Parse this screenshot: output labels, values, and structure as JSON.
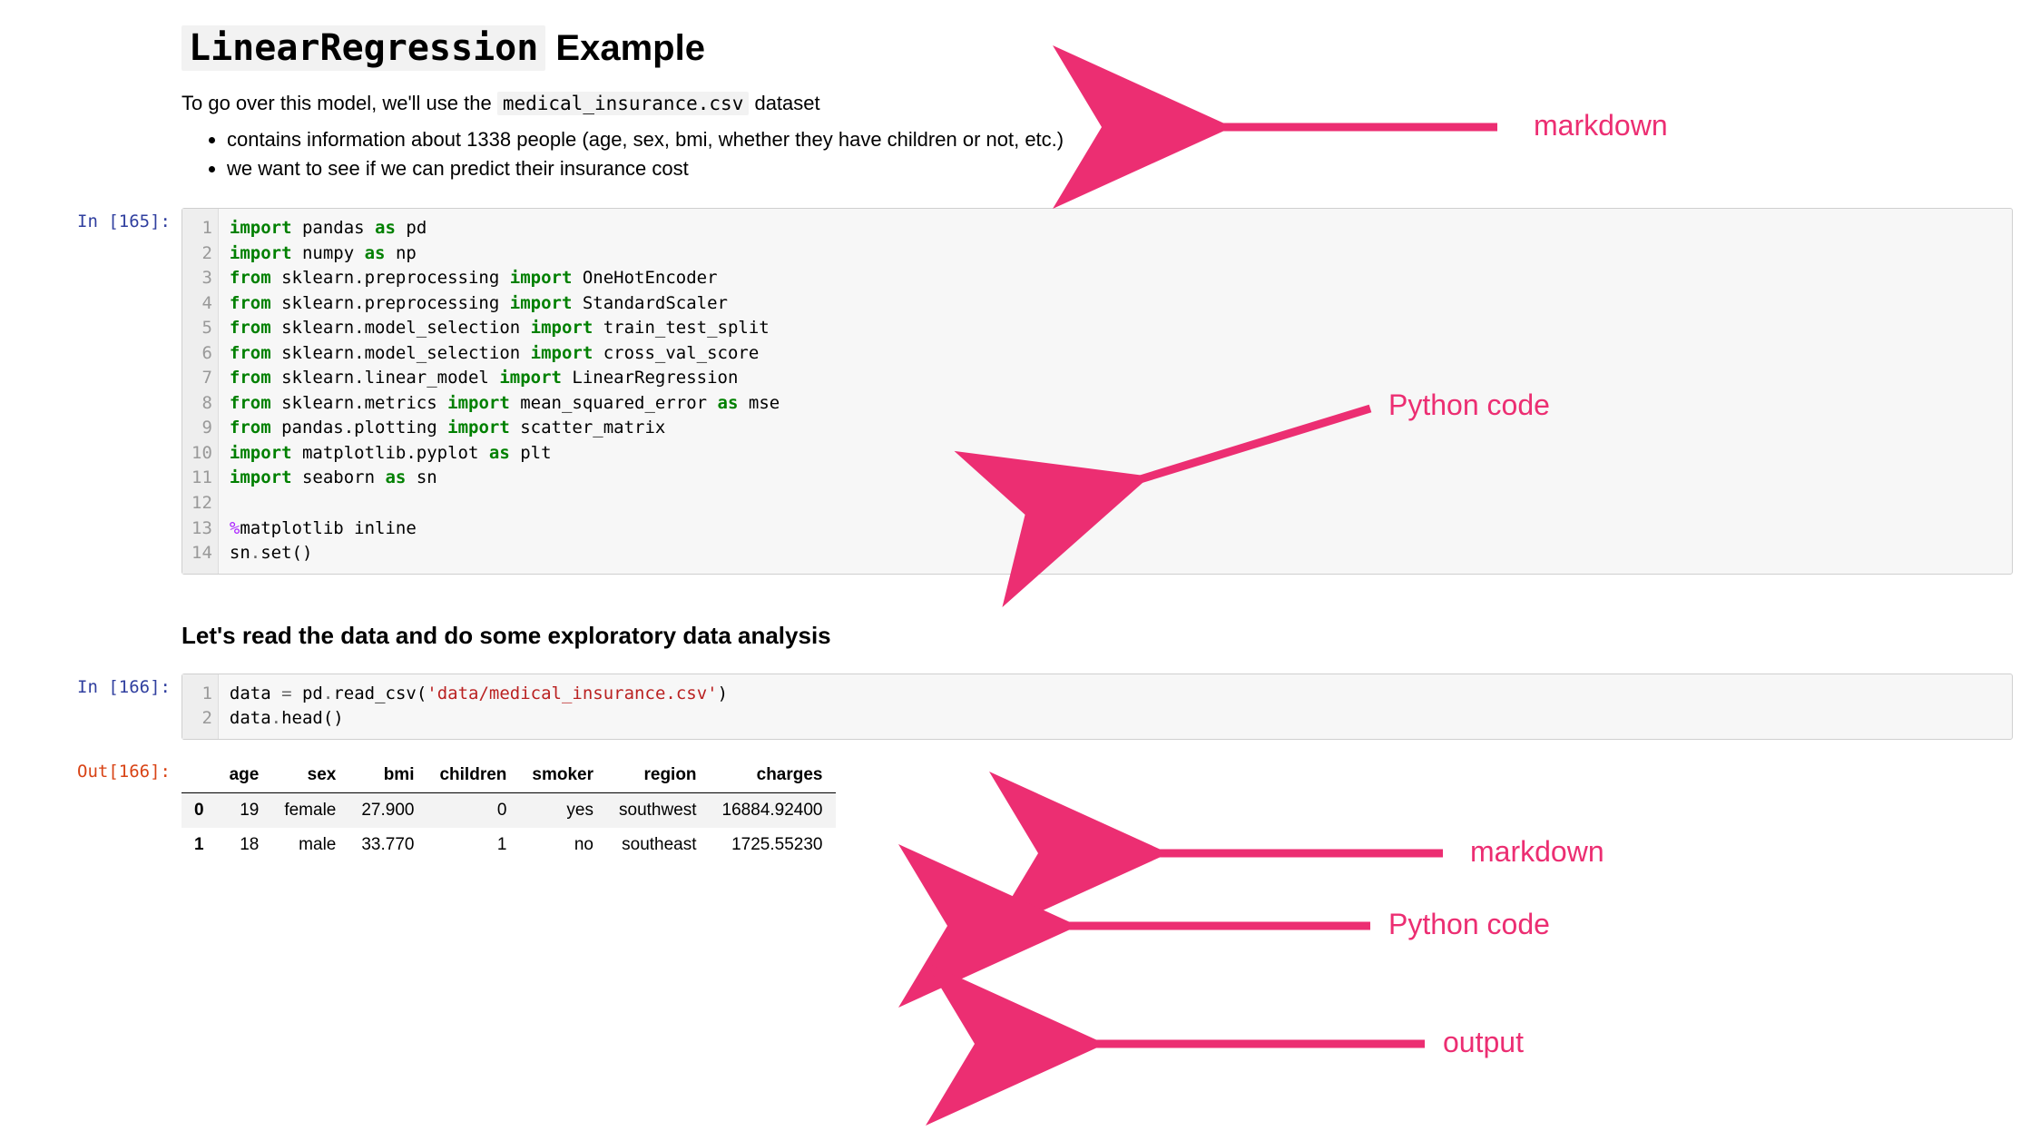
{
  "heading": {
    "code_part": "LinearRegression",
    "rest": " Example"
  },
  "intro": {
    "prefix": "To go over this model, we'll use the ",
    "code": "medical_insurance.csv",
    "suffix": " dataset"
  },
  "bullets": [
    "contains information about 1338 people (age, sex, bmi, whether they have children or not, etc.)",
    "we want to see if we can predict their insurance cost"
  ],
  "cell1": {
    "prompt": "In [165]:",
    "line_numbers": [
      "1",
      "2",
      "3",
      "4",
      "5",
      "6",
      "7",
      "8",
      "9",
      "10",
      "11",
      "12",
      "13",
      "14"
    ],
    "lines": [
      {
        "t": [
          {
            "c": "kw-green",
            "v": "import"
          },
          {
            "v": " pandas "
          },
          {
            "c": "kw-green",
            "v": "as"
          },
          {
            "v": " pd"
          }
        ]
      },
      {
        "t": [
          {
            "c": "kw-green",
            "v": "import"
          },
          {
            "v": " numpy "
          },
          {
            "c": "kw-green",
            "v": "as"
          },
          {
            "v": " np"
          }
        ]
      },
      {
        "t": [
          {
            "c": "kw-green",
            "v": "from"
          },
          {
            "v": " sklearn.preprocessing "
          },
          {
            "c": "kw-green",
            "v": "import"
          },
          {
            "v": " OneHotEncoder"
          }
        ]
      },
      {
        "t": [
          {
            "c": "kw-green",
            "v": "from"
          },
          {
            "v": " sklearn.preprocessing "
          },
          {
            "c": "kw-green",
            "v": "import"
          },
          {
            "v": " StandardScaler"
          }
        ]
      },
      {
        "t": [
          {
            "c": "kw-green",
            "v": "from"
          },
          {
            "v": " sklearn.model_selection "
          },
          {
            "c": "kw-green",
            "v": "import"
          },
          {
            "v": " train_test_split"
          }
        ]
      },
      {
        "t": [
          {
            "c": "kw-green",
            "v": "from"
          },
          {
            "v": " sklearn.model_selection "
          },
          {
            "c": "kw-green",
            "v": "import"
          },
          {
            "v": " cross_val_score"
          }
        ]
      },
      {
        "t": [
          {
            "c": "kw-green",
            "v": "from"
          },
          {
            "v": " sklearn.linear_model "
          },
          {
            "c": "kw-green",
            "v": "import"
          },
          {
            "v": " LinearRegression"
          }
        ]
      },
      {
        "t": [
          {
            "c": "kw-green",
            "v": "from"
          },
          {
            "v": " sklearn.metrics "
          },
          {
            "c": "kw-green",
            "v": "import"
          },
          {
            "v": " mean_squared_error "
          },
          {
            "c": "kw-green",
            "v": "as"
          },
          {
            "v": " mse"
          }
        ]
      },
      {
        "t": [
          {
            "c": "kw-green",
            "v": "from"
          },
          {
            "v": " pandas.plotting "
          },
          {
            "c": "kw-green",
            "v": "import"
          },
          {
            "v": " scatter_matrix"
          }
        ]
      },
      {
        "t": [
          {
            "c": "kw-green",
            "v": "import"
          },
          {
            "v": " matplotlib.pyplot "
          },
          {
            "c": "kw-green",
            "v": "as"
          },
          {
            "v": " plt"
          }
        ]
      },
      {
        "t": [
          {
            "c": "kw-green",
            "v": "import"
          },
          {
            "v": " seaborn "
          },
          {
            "c": "kw-green",
            "v": "as"
          },
          {
            "v": " sn"
          }
        ]
      },
      {
        "t": [
          {
            "v": ""
          }
        ]
      },
      {
        "t": [
          {
            "c": "magic",
            "v": "%"
          },
          {
            "v": "matplotlib inline"
          }
        ]
      },
      {
        "t": [
          {
            "v": "sn"
          },
          {
            "c": "op",
            "v": "."
          },
          {
            "v": "set()"
          }
        ]
      }
    ]
  },
  "subheading": "Let's read the data and do some exploratory data analysis",
  "cell2": {
    "prompt": "In [166]:",
    "line_numbers": [
      "1",
      "2"
    ],
    "lines": [
      {
        "t": [
          {
            "v": "data "
          },
          {
            "c": "op",
            "v": "="
          },
          {
            "v": " pd"
          },
          {
            "c": "op",
            "v": "."
          },
          {
            "v": "read_csv("
          },
          {
            "c": "str",
            "v": "'data/medical_insurance.csv'"
          },
          {
            "v": ")"
          }
        ]
      },
      {
        "t": [
          {
            "v": "data"
          },
          {
            "c": "op",
            "v": "."
          },
          {
            "v": "head()"
          }
        ]
      }
    ]
  },
  "out2": {
    "prompt": "Out[166]:",
    "headers": [
      "",
      "age",
      "sex",
      "bmi",
      "children",
      "smoker",
      "region",
      "charges"
    ],
    "rows": [
      [
        "0",
        "19",
        "female",
        "27.900",
        "0",
        "yes",
        "southwest",
        "16884.92400"
      ],
      [
        "1",
        "18",
        "male",
        "33.770",
        "1",
        "no",
        "southeast",
        "1725.55230"
      ]
    ]
  },
  "annotations": {
    "a1": "markdown",
    "a2": "Python code",
    "a3": "markdown",
    "a4": "Python code",
    "a5": "output"
  }
}
